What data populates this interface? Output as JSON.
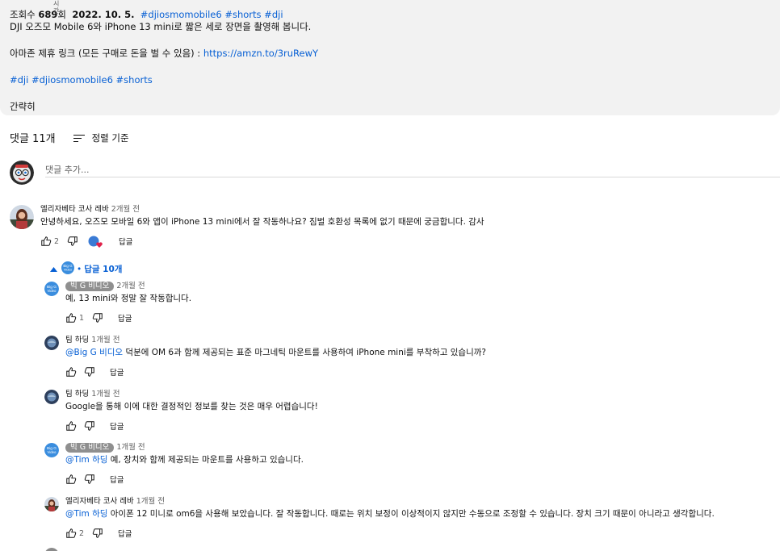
{
  "description": {
    "tiny_label": "시\n간",
    "views": "조회수",
    "views_count": "689",
    "views_suffix": "회",
    "date": "2022. 10. 5.",
    "hashtags_top": "#djiosmomobile6 #shorts #dji",
    "line1": "DJI 오즈모 Mobile 6와 iPhone 13 mini로 짧은 세로 장면을 촬영해 봅니다.",
    "affiliate_text": "아마존 제휴 링크 (모든 구매로 돈을 벌 수 있음) : ",
    "affiliate_link": "https://amzn.to/3ruRewY",
    "hashtags_bottom": "#dji #djiosmomobile6 #shorts",
    "collapse_label": "간략히"
  },
  "comments_header": {
    "count_label": "댓글 11개",
    "sort_label": "정렬 기준"
  },
  "add_comment": {
    "placeholder": "댓글 추가..."
  },
  "thread": {
    "top": {
      "author": "엘리자베타 코사 레바",
      "time": "2개월 전",
      "text": "안녕하세요, 오즈모 모바일 6와 앱이 iPhone 13 mini에서 잘 작동하나요? 짐벌 호환성 목록에 없기 때문에 궁금합니다. 감사",
      "likes": "2",
      "reply_label": "답글"
    },
    "replies_toggle": {
      "dot": "•",
      "label": "답글 10개"
    },
    "replies": [
      {
        "author": "빅 G 비디오",
        "time": "2개월 전",
        "mention": "",
        "text": "예, 13 mini와 정말 잘 작동합니다.",
        "likes": "1",
        "reply_label": "답글"
      },
      {
        "author": "팀 하딩",
        "time": "1개월 전",
        "mention": "@Big G 비디오",
        "text": " 덕분에 OM 6과 함께 제공되는 표준 마그네틱 마운트를 사용하여 iPhone mini를 부착하고 있습니까?",
        "likes": "",
        "reply_label": "답글"
      },
      {
        "author": "팀 하딩",
        "time": "1개월 전",
        "mention": "",
        "text": "Google을 통해 이에 대한 결정적인 정보를 찾는 것은 매우 어렵습니다!",
        "likes": "",
        "reply_label": "답글"
      },
      {
        "author": "빅 G 비디오",
        "time": "1개월 전",
        "mention": "@Tim 하딩",
        "text": " 예, 장치와 함께 제공되는 마운트를 사용하고 있습니다.",
        "likes": "",
        "reply_label": "답글"
      },
      {
        "author": "엘리자베타 코사 레바",
        "time": "1개월 전",
        "mention": "@Tim 하딩",
        "text": " 아이폰 12 미니로 om6을 사용해 보았습니다. 잘 작동합니다. 때로는 위치 보정이 이상적이지 않지만 수동으로 조정할 수 있습니다. 장치 크기 때문이 아니라고 생각합니다.",
        "likes": "2",
        "reply_label": "답글"
      }
    ]
  },
  "colors": {
    "link": "#065fd4",
    "description_bg": "#f2f2f2",
    "chip_bg": "#8f8f8f",
    "heart": "#e0224b"
  }
}
